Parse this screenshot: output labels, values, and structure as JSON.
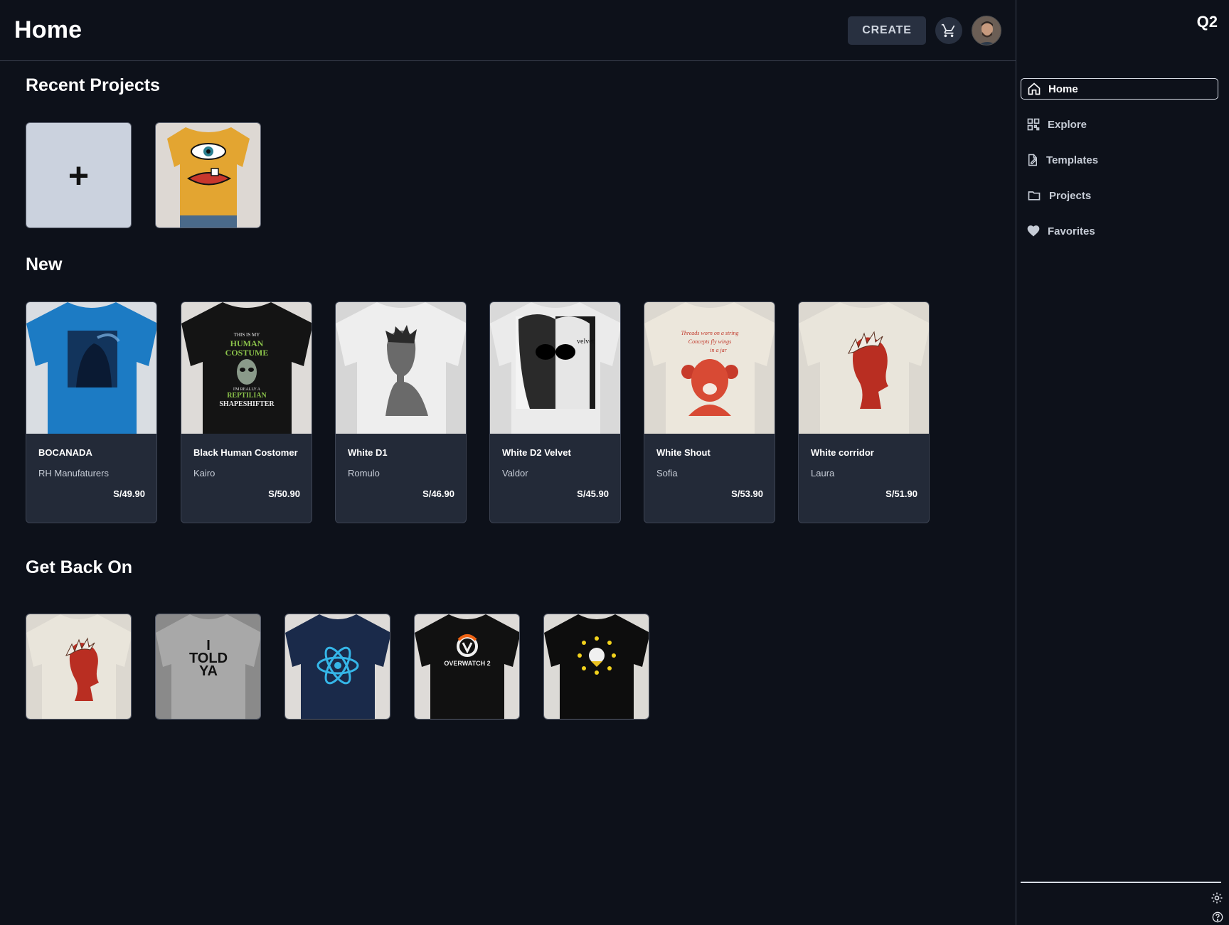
{
  "header": {
    "title": "Home",
    "create_label": "CREATE",
    "cart_icon": "cart-icon",
    "avatar_icon": "user-avatar"
  },
  "sections": {
    "recent_projects": "Recent Projects",
    "new": "New",
    "get_back_on": "Get Back On"
  },
  "recent_projects": {
    "add_symbol": "+",
    "items": [
      {
        "shirt_color": "#e3a531",
        "design": "cyclops-face"
      }
    ]
  },
  "new_products": [
    {
      "name": "BOCANADA",
      "author": "RH Manufaturers",
      "price": "S/49.90",
      "shirt_color": "#1c7bc4",
      "design": "smoke-portrait-blue"
    },
    {
      "name": "Black Human Costomer",
      "author": "Kairo",
      "price": "S/50.90",
      "shirt_color": "#141414",
      "design": "human-costume-alien"
    },
    {
      "name": "White D1",
      "author": "Romulo",
      "price": "S/46.90",
      "shirt_color": "#eeeeee",
      "design": "bw-portrait"
    },
    {
      "name": "White D2 Velvet",
      "author": "Valdor",
      "price": "S/45.90",
      "shirt_color": "#ebebeb",
      "design": "velvet-sunglasses-portrait"
    },
    {
      "name": "White Shout",
      "author": "Sofia",
      "price": "S/53.90",
      "shirt_color": "#ece7dc",
      "design": "red-shout-portrait"
    },
    {
      "name": "White corridor",
      "author": "Laura",
      "price": "S/51.90",
      "shirt_color": "#e9e5db",
      "design": "red-profile-head"
    }
  ],
  "get_back_on": [
    {
      "shirt_color": "#e9e5db",
      "design": "red-profile-head"
    },
    {
      "shirt_color": "#a8a8a8",
      "design": "i-told-ya-text",
      "text": "I\nTOLD\nYA"
    },
    {
      "shirt_color": "#1a2a4a",
      "design": "react-atom-logo"
    },
    {
      "shirt_color": "#111111",
      "design": "overwatch-logo",
      "text": "OVERWATCH 2"
    },
    {
      "shirt_color": "#0d0d0d",
      "design": "yellow-dot-circle"
    }
  ],
  "sidebar": {
    "brand": "Q2",
    "items": [
      {
        "label": "Home",
        "icon": "home-icon",
        "active": true
      },
      {
        "label": "Explore",
        "icon": "grid-icon",
        "active": false
      },
      {
        "label": "Templates",
        "icon": "edit-document-icon",
        "active": false
      },
      {
        "label": "Projects",
        "icon": "folder-icon",
        "active": false
      },
      {
        "label": "Favorites",
        "icon": "heart-icon",
        "active": false
      }
    ],
    "footer_icons": [
      "settings-icon",
      "help-icon"
    ]
  }
}
